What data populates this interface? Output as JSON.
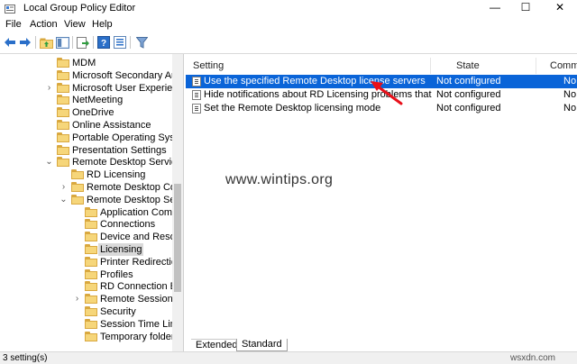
{
  "window": {
    "title": "Local Group Policy Editor",
    "controls": {
      "minimize": "—",
      "maximize": "☐",
      "close": "✕"
    }
  },
  "menu": {
    "items": [
      "File",
      "Action",
      "View",
      "Help"
    ]
  },
  "toolbar": {
    "buttons": [
      "back-icon",
      "forward-icon",
      "up-folder-icon",
      "show-hide-tree-icon",
      "export-list-icon",
      "help-icon",
      "properties-icon",
      "filter-icon"
    ]
  },
  "tree": {
    "items": [
      {
        "label": "MDM",
        "indent": 1,
        "expander": ""
      },
      {
        "label": "Microsoft Secondary Authe",
        "indent": 1,
        "expander": ""
      },
      {
        "label": "Microsoft User Experience V",
        "indent": 1,
        "expander": ">"
      },
      {
        "label": "NetMeeting",
        "indent": 1,
        "expander": ""
      },
      {
        "label": "OneDrive",
        "indent": 1,
        "expander": ""
      },
      {
        "label": "Online Assistance",
        "indent": 1,
        "expander": ""
      },
      {
        "label": "Portable Operating System",
        "indent": 1,
        "expander": ""
      },
      {
        "label": "Presentation Settings",
        "indent": 1,
        "expander": ""
      },
      {
        "label": "Remote Desktop Services",
        "indent": 1,
        "expander": "v"
      },
      {
        "label": "RD Licensing",
        "indent": 2,
        "expander": ""
      },
      {
        "label": "Remote Desktop Conne",
        "indent": 2,
        "expander": ">"
      },
      {
        "label": "Remote Desktop Sessio",
        "indent": 2,
        "expander": "v"
      },
      {
        "label": "Application Compat",
        "indent": 3,
        "expander": ""
      },
      {
        "label": "Connections",
        "indent": 3,
        "expander": ""
      },
      {
        "label": "Device and Resource",
        "indent": 3,
        "expander": ""
      },
      {
        "label": "Licensing",
        "indent": 3,
        "expander": "",
        "selected": true
      },
      {
        "label": "Printer Redirection",
        "indent": 3,
        "expander": ""
      },
      {
        "label": "Profiles",
        "indent": 3,
        "expander": ""
      },
      {
        "label": "RD Connection Brok",
        "indent": 3,
        "expander": ""
      },
      {
        "label": "Remote Session Env",
        "indent": 3,
        "expander": ">"
      },
      {
        "label": "Security",
        "indent": 3,
        "expander": ""
      },
      {
        "label": "Session Time Limits",
        "indent": 3,
        "expander": ""
      },
      {
        "label": "Temporary folders",
        "indent": 3,
        "expander": ""
      }
    ]
  },
  "settings": {
    "columns": [
      "Setting",
      "State",
      "Comm"
    ],
    "rows": [
      {
        "name": "Use the specified Remote Desktop license servers",
        "state": "Not configured",
        "comment": "No",
        "selected": true
      },
      {
        "name": "Hide notifications about RD Licensing problems that affect t...",
        "state": "Not configured",
        "comment": "No"
      },
      {
        "name": "Set the Remote Desktop licensing mode",
        "state": "Not configured",
        "comment": "No"
      }
    ]
  },
  "watermark": "www.wintips.org",
  "tabs": {
    "extended": "Extended",
    "standard": "Standard"
  },
  "status": {
    "text": "3 setting(s)"
  },
  "corner_watermark": "wsxdn.com",
  "colors": {
    "selection": "#0a64d8",
    "arrow": "#e8101a",
    "folder": "#f6d67a"
  }
}
